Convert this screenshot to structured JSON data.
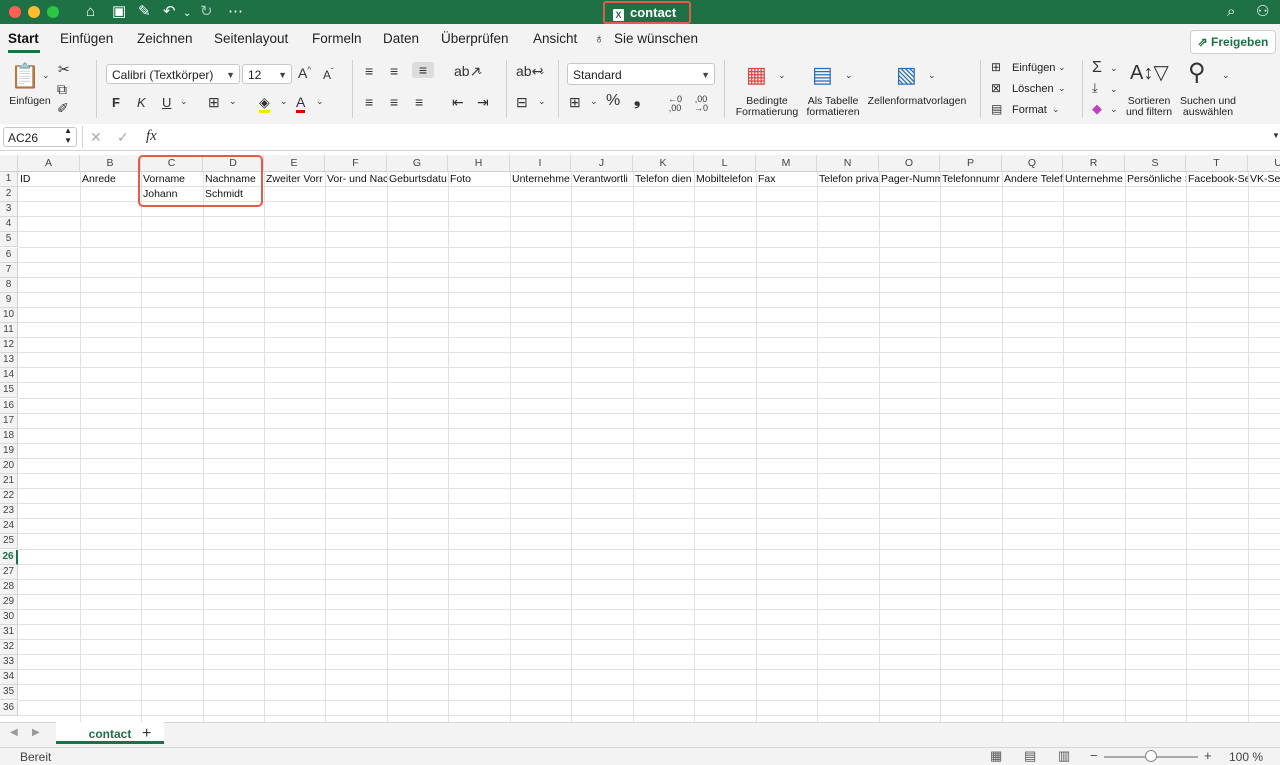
{
  "window": {
    "title": "contact",
    "traffic_colors": [
      "#ff5f57",
      "#febc2e",
      "#28c840"
    ]
  },
  "titlebar_icons": [
    "home-icon",
    "save-icon",
    "save-as-icon",
    "undo-icon",
    "redo-icon",
    "more-icon",
    "search-icon",
    "share-person-icon"
  ],
  "tabs": [
    "Start",
    "Einfügen",
    "Zeichnen",
    "Seitenlayout",
    "Formeln",
    "Daten",
    "Überprüfen",
    "Ansicht"
  ],
  "tell_me": "Sie wünschen",
  "share_label": "Freigeben",
  "ribbon": {
    "paste_label": "Einfügen",
    "font_name": "Calibri (Textkörper)",
    "font_size": "12",
    "bold": "F",
    "italic": "K",
    "underline": "U",
    "number_format": "Standard",
    "cond_format": [
      "Bedingte",
      "Formatierung"
    ],
    "as_table": [
      "Als Tabelle",
      "formatieren"
    ],
    "cell_styles": "Zellenformatvorlagen",
    "insert": "Einfügen",
    "delete": "Löschen",
    "format": "Format",
    "sort": [
      "Sortieren",
      "und filtern"
    ],
    "find": [
      "Suchen und",
      "auswählen"
    ]
  },
  "formula_bar": {
    "name_box": "AC26",
    "fx": "fx",
    "value": ""
  },
  "grid": {
    "columns": [
      "A",
      "B",
      "C",
      "D",
      "E",
      "F",
      "G",
      "H",
      "I",
      "J",
      "K",
      "L",
      "M",
      "N",
      "O",
      "P",
      "Q",
      "R",
      "S",
      "T",
      "U"
    ],
    "rows": 36,
    "selected_row": 26,
    "cells": {
      "row1": [
        "ID",
        "Anrede",
        "Vorname",
        "Nachname",
        "Zweiter Vorr",
        "Vor- und Nac",
        "Geburtsdatu",
        "Foto",
        "Unternehme",
        "Verantwortli",
        "Telefon dien",
        "Mobiltelefon",
        "Fax",
        "Telefon priva",
        "Pager-Numm",
        "Telefonnumr",
        "Andere Telef",
        "Unternehme",
        "Persönliche S",
        "Facebook-Se",
        "VK-Sei"
      ],
      "row2": [
        "",
        "",
        "Johann",
        "Schmidt"
      ]
    }
  },
  "sheet": {
    "name": "contact",
    "add": "+"
  },
  "status": {
    "text": "Bereit",
    "zoom": "100 %",
    "zoom_level": 0.5,
    "minus": "−",
    "plus": "+"
  },
  "accent": "#1e7145",
  "highlight_color": "#e35b4b"
}
